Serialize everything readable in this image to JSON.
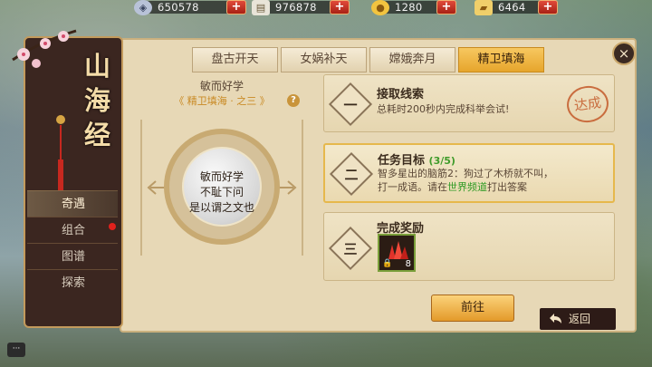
{
  "resources": [
    {
      "icon": "silver-coin-icon",
      "value": "650578"
    },
    {
      "icon": "scroll-icon",
      "value": "976878"
    },
    {
      "icon": "gold-coin-icon",
      "value": "1280"
    },
    {
      "icon": "gold-ingot-icon",
      "value": "6464"
    }
  ],
  "plus_label": "+",
  "close_label": "×",
  "title_chars": [
    "山",
    "海",
    "经"
  ],
  "menu": [
    {
      "label": "奇遇",
      "active": true
    },
    {
      "label": "组合",
      "badge": true
    },
    {
      "label": "图谱"
    },
    {
      "label": "探索"
    }
  ],
  "tabs": [
    "盘古开天",
    "女娲补天",
    "嫦娥奔月",
    "精卫填海"
  ],
  "active_tab": 3,
  "puzzle": {
    "title": "敏而好学",
    "subtitle": "《 精卫填海 · 之三 》",
    "help": "?",
    "lines": [
      "敏而好学",
      "不耻下问",
      "是以谓之文也"
    ]
  },
  "tasks": [
    {
      "num": "一",
      "title": "接取线索",
      "desc": "总耗时200秒内完成科举会试!",
      "stamp": "达成"
    },
    {
      "num": "二",
      "title": "任务目标",
      "progress": "(3/5)",
      "desc_1": "智多星出的脑筋2：狗过了木桥就不叫，",
      "desc_2a": "打一成语。请在",
      "desc_2b": "世界频道",
      "desc_2c": "打出答案"
    },
    {
      "num": "三",
      "title": "完成奖励",
      "reward_count": "8"
    }
  ],
  "go_label": "前往",
  "back_label": "返回",
  "chat_label": "···",
  "colors": {
    "accent": "#e6a52c",
    "panel": "#e7d8b6",
    "dark": "#3b2620",
    "green": "#2f9a25"
  }
}
